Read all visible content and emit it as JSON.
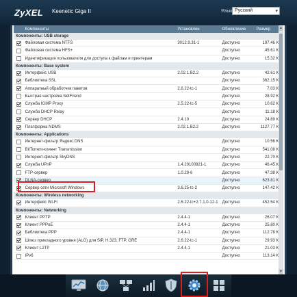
{
  "header": {
    "logo": "ZyXEL",
    "model": "Keenetic Giga II",
    "lang_label": "Язык:",
    "lang_value": "Русский"
  },
  "table": {
    "columns": [
      "Компоненты",
      "Установлен",
      "Обновление",
      "Размер"
    ],
    "groups": [
      {
        "title": "Компоненты: USB storage",
        "rows": [
          {
            "checked": true,
            "name": "Файловая система NTFS",
            "version": "3012.9.31-1",
            "status": "Доступно",
            "size": "197.46 КБ"
          },
          {
            "checked": false,
            "name": "Файловая система HFS+",
            "version": "",
            "status": "Доступно",
            "size": "45.61 КБ"
          },
          {
            "checked": false,
            "name": "Идентификация пользователя для доступа к файлам и принтерам",
            "version": "",
            "status": "Доступно",
            "size": "15.32 КБ"
          }
        ]
      },
      {
        "title": "Компоненты: Base system",
        "rows": [
          {
            "checked": true,
            "name": "Интерфейс USB",
            "version": "2.02.1.B2.2",
            "status": "Доступно",
            "size": "42.61 КБ"
          },
          {
            "checked": true,
            "name": "Библиотека SSL",
            "version": "",
            "status": "Доступно",
            "size": "362.15 КБ"
          },
          {
            "checked": true,
            "name": "Аппаратный обработчик пакетов",
            "version": "2.6.22-tc-1",
            "status": "Доступно",
            "size": "7.03 КБ"
          },
          {
            "checked": false,
            "name": "Быстрая настройка NetFriend",
            "version": "",
            "status": "Доступно",
            "size": "28.92 КБ"
          },
          {
            "checked": true,
            "name": "Служба IGMP Proxy",
            "version": "2.5.22-tc-5",
            "status": "Доступно",
            "size": "10.62 КБ"
          },
          {
            "checked": false,
            "name": "Служба DHCP Relay",
            "version": "",
            "status": "Доступно",
            "size": "11.18 КБ"
          },
          {
            "checked": true,
            "name": "Сервер DHCP",
            "version": "2.4.10",
            "status": "Доступно",
            "size": "24.89 КБ"
          },
          {
            "checked": true,
            "name": "Платформа NDMS",
            "version": "2.02.1.B2.2",
            "status": "Доступно",
            "size": "1127.77 КБ"
          }
        ]
      },
      {
        "title": "Компоненты: Applications",
        "rows": [
          {
            "checked": false,
            "name": "Интернет-фильтр Яндекс.DNS",
            "version": "",
            "status": "Доступно",
            "size": "10.56 КБ"
          },
          {
            "checked": false,
            "name": "BitTorrent-клиент Transmission",
            "version": "",
            "status": "Доступно",
            "size": "541.08 КБ"
          },
          {
            "checked": false,
            "name": "Интернет-фильтр SkyDNS",
            "version": "",
            "status": "Доступно",
            "size": "22.70 КБ"
          },
          {
            "checked": true,
            "name": "Служба UPnP",
            "version": "1.4.20100921-1",
            "status": "Доступно",
            "size": "46.45 КБ"
          },
          {
            "checked": false,
            "name": "FTP-сервер",
            "version": "1.0.29-6",
            "status": "Доступно",
            "size": "47.38 КБ"
          },
          {
            "checked": true,
            "name": "DLNA-сервер",
            "version": "",
            "status": "Доступно",
            "size": "623.81 КБ",
            "highlight": true
          },
          {
            "checked": true,
            "name": "Сервер сети Microsoft Windows",
            "version": "3.6.25-tc-2",
            "status": "Доступно",
            "size": "147.42 КБ"
          }
        ]
      },
      {
        "title": "Компоненты: Wireless networking",
        "rows": [
          {
            "checked": true,
            "name": "Интерфейс Wi-Fi",
            "version": "2.6.22-tc+2.7.1.0-12-1",
            "status": "Доступно",
            "size": "452.54 КБ"
          }
        ]
      },
      {
        "title": "Компоненты: Networking",
        "rows": [
          {
            "checked": true,
            "name": "Клиент PPTP",
            "version": "2.4.4-1",
            "status": "Доступно",
            "size": "26.07 КБ"
          },
          {
            "checked": true,
            "name": "Клиент PPPoE",
            "version": "2.4.4-1",
            "status": "Доступно",
            "size": "25.80 КБ"
          },
          {
            "checked": true,
            "name": "Библиотека PPP",
            "version": "2.4.4-1",
            "status": "Доступно",
            "size": "112.78 КБ"
          },
          {
            "checked": true,
            "name": "Шлюз прикладного уровня (ALG) для SIP, H.323, FTP, GRE",
            "version": "2.6.22-tc-1",
            "status": "Доступно",
            "size": "29.93 КБ"
          },
          {
            "checked": true,
            "name": "Клиент L2TP",
            "version": "2.4.4-1",
            "status": "Доступно",
            "size": "21.03 КБ"
          },
          {
            "checked": false,
            "name": "IPv6",
            "version": "",
            "status": "Доступно",
            "size": "113.14 КБ"
          }
        ]
      }
    ]
  },
  "dock": {
    "icons": [
      "monitor-graph-icon",
      "globe-icon",
      "network-computers-icon",
      "signal-bars-icon",
      "shield-icon",
      "gear-icon",
      "grid-apps-icon"
    ],
    "active": "gear-icon"
  },
  "colors": {
    "header_bg": "#102637",
    "table_header": "#5b7a93",
    "group_bg": "#e3e8ed",
    "highlight_border": "#d42020"
  }
}
